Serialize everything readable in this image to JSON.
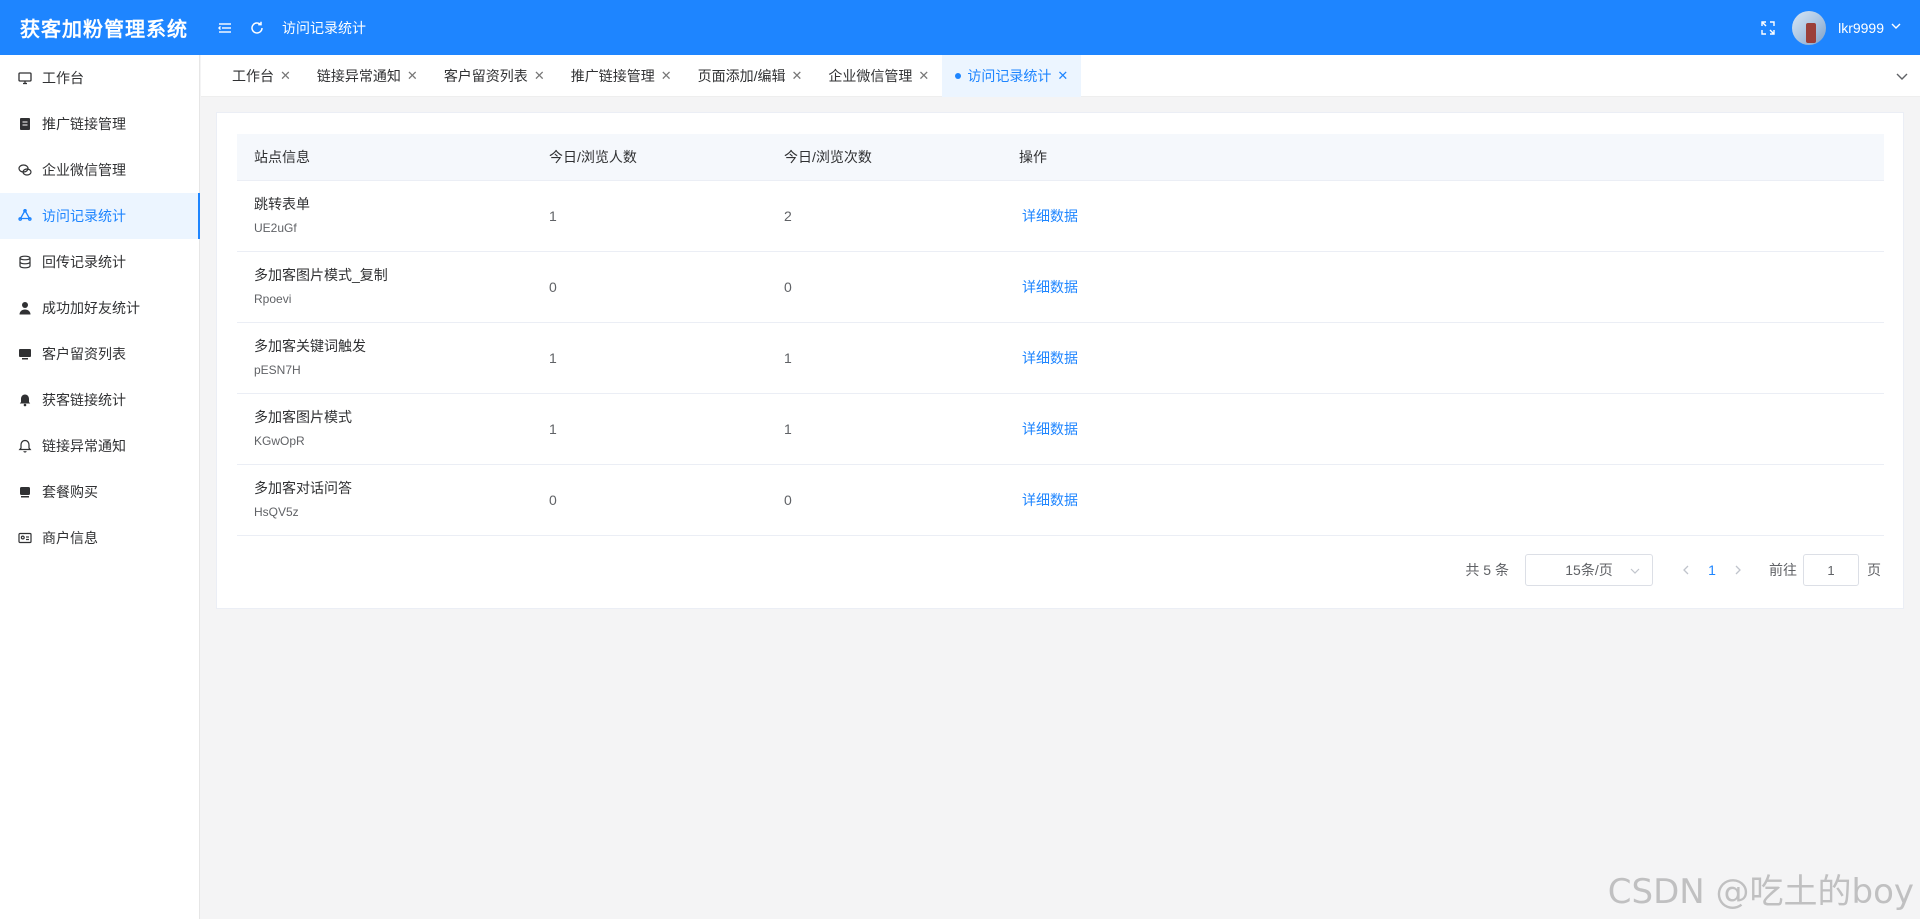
{
  "app": {
    "title": "获客加粉管理系统"
  },
  "header": {
    "breadcrumb": "访问记录统计",
    "username": "lkr9999"
  },
  "sidebar": {
    "items": [
      {
        "label": "工作台",
        "icon": "monitor-icon"
      },
      {
        "label": "推广链接管理",
        "icon": "document-icon"
      },
      {
        "label": "企业微信管理",
        "icon": "wechat-icon"
      },
      {
        "label": "访问记录统计",
        "icon": "recycle-icon",
        "active": true
      },
      {
        "label": "回传记录统计",
        "icon": "database-icon"
      },
      {
        "label": "成功加好友统计",
        "icon": "user-icon"
      },
      {
        "label": "客户留资列表",
        "icon": "screen-icon"
      },
      {
        "label": "获客链接统计",
        "icon": "bell-filled-icon"
      },
      {
        "label": "链接异常通知",
        "icon": "bell-icon"
      },
      {
        "label": "套餐购买",
        "icon": "box-icon"
      },
      {
        "label": "商户信息",
        "icon": "id-card-icon"
      }
    ]
  },
  "tabs": [
    {
      "label": "工作台"
    },
    {
      "label": "链接异常通知"
    },
    {
      "label": "客户留资列表"
    },
    {
      "label": "推广链接管理"
    },
    {
      "label": "页面添加/编辑"
    },
    {
      "label": "企业微信管理"
    },
    {
      "label": "访问记录统计",
      "active": true
    }
  ],
  "table": {
    "headers": [
      "站点信息",
      "今日/浏览人数",
      "今日/浏览次数",
      "操作"
    ],
    "rows": [
      {
        "name": "跳转表单",
        "code": "UE2uGf",
        "visitors": "1",
        "views": "2",
        "action": "详细数据"
      },
      {
        "name": "多加客图片模式_复制",
        "code": "Rpoevi",
        "visitors": "0",
        "views": "0",
        "action": "详细数据"
      },
      {
        "name": "多加客关键词触发",
        "code": "pESN7H",
        "visitors": "1",
        "views": "1",
        "action": "详细数据"
      },
      {
        "name": "多加客图片模式",
        "code": "KGwOpR",
        "visitors": "1",
        "views": "1",
        "action": "详细数据"
      },
      {
        "name": "多加客对话问答",
        "code": "HsQV5z",
        "visitors": "0",
        "views": "0",
        "action": "详细数据"
      }
    ]
  },
  "pagination": {
    "total": "共 5 条",
    "page_size": "15条/页",
    "current": "1",
    "goto_label": "前往",
    "goto_value": "1",
    "page_suffix": "页"
  },
  "watermark": "CSDN @吃土的boy",
  "colors": {
    "primary": "#1e85ff",
    "active_bg": "#ecf5ff"
  }
}
